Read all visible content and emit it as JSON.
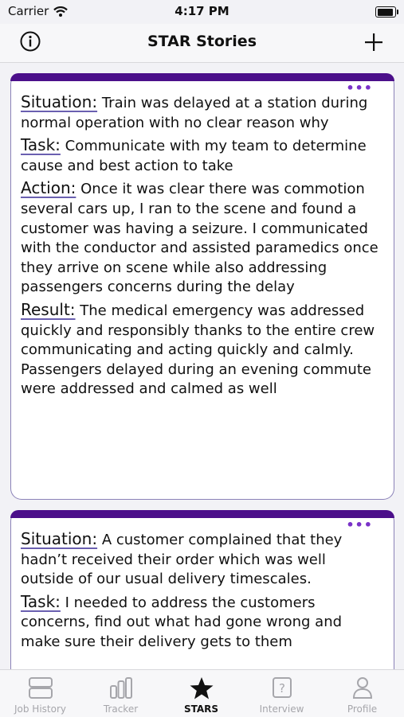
{
  "status_bar": {
    "carrier": "Carrier",
    "time": "4:17 PM"
  },
  "navbar": {
    "title": "STAR Stories",
    "info_icon": "info-icon",
    "add_icon": "plus-icon"
  },
  "stories": [
    {
      "menu": "•••",
      "situation_label": "Situation:",
      "situation": "Train was delayed at a station during normal operation with no clear reason why",
      "task_label": "Task:",
      "task": "Communicate with my team to determine cause and best action to take",
      "action_label": "Action:",
      "action": "Once it was clear there was commotion several cars up, I ran to the scene and found a customer was having a seizure. I communicated with the conductor and assisted paramedics once they arrive on scene while also addressing passengers concerns during the delay",
      "result_label": "Result:",
      "result": "The medical emergency was addressed quickly and responsibly thanks to the entire crew communicating and acting quickly and calmly. Passengers delayed during an evening commute were addressed and calmed as well"
    },
    {
      "menu": "•••",
      "situation_label": "Situation:",
      "situation": "A customer complained that they hadn’t received their order which was well outside of our usual delivery timescales.",
      "task_label": "Task:",
      "task": "I needed to address the customers concerns, find out what had gone wrong and make sure their delivery gets to them"
    }
  ],
  "tabs": [
    {
      "label": "Job History",
      "icon": "job-history-icon",
      "active": false
    },
    {
      "label": "Tracker",
      "icon": "bar-chart-icon",
      "active": false
    },
    {
      "label": "STARS",
      "icon": "star-icon",
      "active": true
    },
    {
      "label": "Interview",
      "icon": "question-icon",
      "active": false
    },
    {
      "label": "Profile",
      "icon": "person-icon",
      "active": false
    }
  ],
  "colors": {
    "accent": "#4b0f8a",
    "dots": "#7a32c8",
    "card_border": "#8b82b8"
  }
}
